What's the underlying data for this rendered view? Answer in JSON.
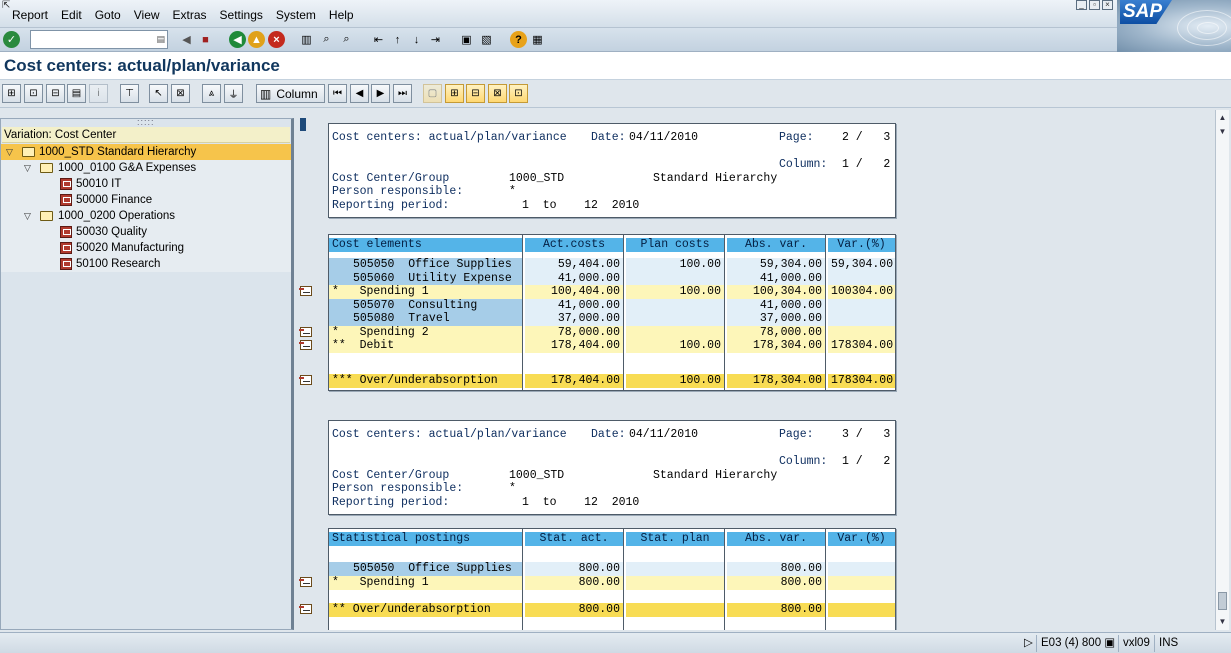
{
  "menu": [
    "Report",
    "Edit",
    "Goto",
    "View",
    "Extras",
    "Settings",
    "System",
    "Help"
  ],
  "window_title": "Cost centers: actual/plan/variance",
  "logo_text": "SAP",
  "command_field": {
    "value": ""
  },
  "app_toolbar": {
    "column_label": "Column"
  },
  "tree": {
    "header": "Variation: Cost Center",
    "nodes": [
      {
        "label": "1000_STD Standard Hierarchy",
        "level": 0,
        "kind": "folder",
        "expanded": true,
        "selected": true
      },
      {
        "label": "1000_0100 G&A Expenses",
        "level": 1,
        "kind": "folder",
        "expanded": true
      },
      {
        "label": "50010 IT",
        "level": 2,
        "kind": "leaf"
      },
      {
        "label": "50000 Finance",
        "level": 2,
        "kind": "leaf"
      },
      {
        "label": "1000_0200 Operations",
        "level": 1,
        "kind": "folder",
        "expanded": true
      },
      {
        "label": "50030 Quality",
        "level": 2,
        "kind": "leaf"
      },
      {
        "label": "50020 Manufacturing",
        "level": 2,
        "kind": "leaf"
      },
      {
        "label": "50100 Research",
        "level": 2,
        "kind": "leaf"
      }
    ]
  },
  "report": {
    "page2": {
      "header": {
        "title": "Cost centers: actual/plan/variance",
        "date_label": "Date:",
        "date": "04/11/2010",
        "page_label": "Page:",
        "page": "2 /   3",
        "column_label": "Column:",
        "column": "1 /   2",
        "cc_group_label": "Cost Center/Group",
        "cc_group": "1000_STD",
        "cc_group_text": "Standard Hierarchy",
        "person_label": "Person responsible:",
        "person": "*",
        "period_label": "Reporting period:",
        "period": "1  to    12  2010"
      },
      "table": {
        "columns": [
          "Cost elements",
          "Act.costs",
          "Plan costs",
          "Abs. var.",
          "Var.(%)"
        ],
        "rows": [
          {
            "style": "blue",
            "cells": [
              "505050  Office Supplies",
              "59,404.00",
              "100.00",
              "59,304.00",
              "59,304.00"
            ]
          },
          {
            "style": "blue",
            "cells": [
              "505060  Utility Expense",
              "41,000.00",
              "",
              "41,000.00",
              ""
            ]
          },
          {
            "style": "yel",
            "icon": true,
            "cells": [
              "*   Spending 1",
              "100,404.00",
              "100.00",
              "100,304.00",
              "100304.00"
            ]
          },
          {
            "style": "blue",
            "cells": [
              "505070  Consulting",
              "41,000.00",
              "",
              "41,000.00",
              ""
            ]
          },
          {
            "style": "blue",
            "cells": [
              "505080  Travel",
              "37,000.00",
              "",
              "37,000.00",
              ""
            ]
          },
          {
            "style": "yel",
            "icon": true,
            "cells": [
              "*   Spending 2",
              "78,000.00",
              "",
              "78,000.00",
              ""
            ]
          },
          {
            "style": "yel",
            "icon": true,
            "cells": [
              "**  Debit",
              "178,404.00",
              "100.00",
              "178,304.00",
              "178304.00"
            ]
          }
        ],
        "total": {
          "cells": [
            "*** Over/underabsorption",
            "178,404.00",
            "100.00",
            "178,304.00",
            "178304.00"
          ]
        }
      }
    },
    "page3": {
      "header": {
        "title": "Cost centers: actual/plan/variance",
        "date_label": "Date:",
        "date": "04/11/2010",
        "page_label": "Page:",
        "page": "3 /   3",
        "column_label": "Column:",
        "column": "1 /   2",
        "cc_group_label": "Cost Center/Group",
        "cc_group": "1000_STD",
        "cc_group_text": "Standard Hierarchy",
        "person_label": "Person responsible:",
        "person": "*",
        "period_label": "Reporting period:",
        "period": "1  to    12  2010"
      },
      "table": {
        "columns": [
          "Statistical postings",
          "Stat. act.",
          "Stat. plan",
          "Abs. var.",
          "Var.(%)"
        ],
        "rows": [
          {
            "style": "blue",
            "cells": [
              "505050  Office Supplies",
              "800.00",
              "",
              "800.00",
              ""
            ]
          },
          {
            "style": "yel",
            "icon": true,
            "cells": [
              "*   Spending 1",
              "800.00",
              "",
              "800.00",
              ""
            ]
          }
        ],
        "total": {
          "cells": [
            "** Over/underabsorption",
            "800.00",
            "",
            "800.00",
            ""
          ]
        }
      }
    }
  },
  "status": {
    "system": "E03 (4) 800",
    "server": "vxl09",
    "mode": "INS"
  },
  "colors": {
    "header_blue": "#54b4e8",
    "total_yellow": "#f8dc54",
    "selection": "#f6c44b"
  }
}
